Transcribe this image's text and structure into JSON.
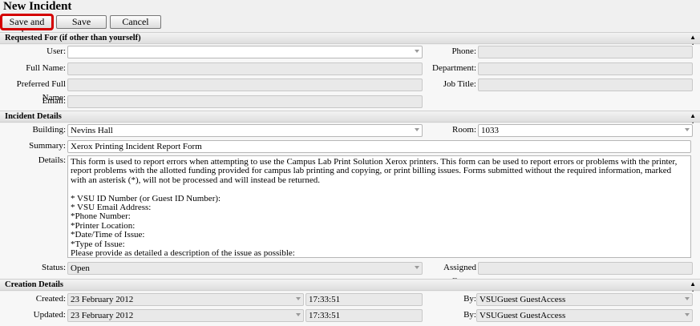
{
  "page_title": "New Incident",
  "toolbar": {
    "save_close": "Save and close",
    "save": "Save",
    "cancel": "Cancel"
  },
  "sections": {
    "requested": "Requested For (if other than yourself)",
    "incident": "Incident Details",
    "creation": "Creation Details"
  },
  "requested": {
    "user_label": "User:",
    "user_value": "",
    "full_name_label": "Full Name:",
    "preferred_label": "Preferred Full Name:",
    "email_label": "Email:",
    "phone_label": "Phone:",
    "department_label": "Department:",
    "job_title_label": "Job Title:"
  },
  "incident": {
    "building_label": "Building:",
    "building_value": "Nevins Hall",
    "room_label": "Room:",
    "room_value": "1033",
    "summary_label": "Summary:",
    "summary_value": "Xerox Printing Incident Report Form",
    "details_label": "Details:",
    "details_value": "This form is used to report errors when attempting to use the Campus Lab Print Solution Xerox printers. This form can be used to report errors or problems with the printer, report problems with the allotted funding provided for campus lab printing and copying, or print billing issues. Forms submitted without the required information, marked with an asterisk (*), will not be processed and will instead be returned.\n\n* VSU ID Number (or Guest ID Number):\n* VSU Email Address:\n*Phone Number:\n*Printer Location:\n*Date/Time of Issue:\n*Type of Issue:\nPlease provide as detailed a description of the issue as possible:",
    "status_label": "Status:",
    "status_value": "Open",
    "assigned_group_label": "Assigned Group:",
    "assigned_group_value": ""
  },
  "creation": {
    "created_label": "Created:",
    "created_date": "23 February 2012",
    "created_time": "17:33:51",
    "updated_label": "Updated:",
    "updated_date": "23 February 2012",
    "updated_time": "17:33:51",
    "by_label": "By:",
    "created_by": "VSUGuest GuestAccess",
    "updated_by": "VSUGuest GuestAccess"
  },
  "icons": {
    "collapse": "double-chevron-up-icon",
    "dropdown": "dropdown-arrow-icon"
  }
}
